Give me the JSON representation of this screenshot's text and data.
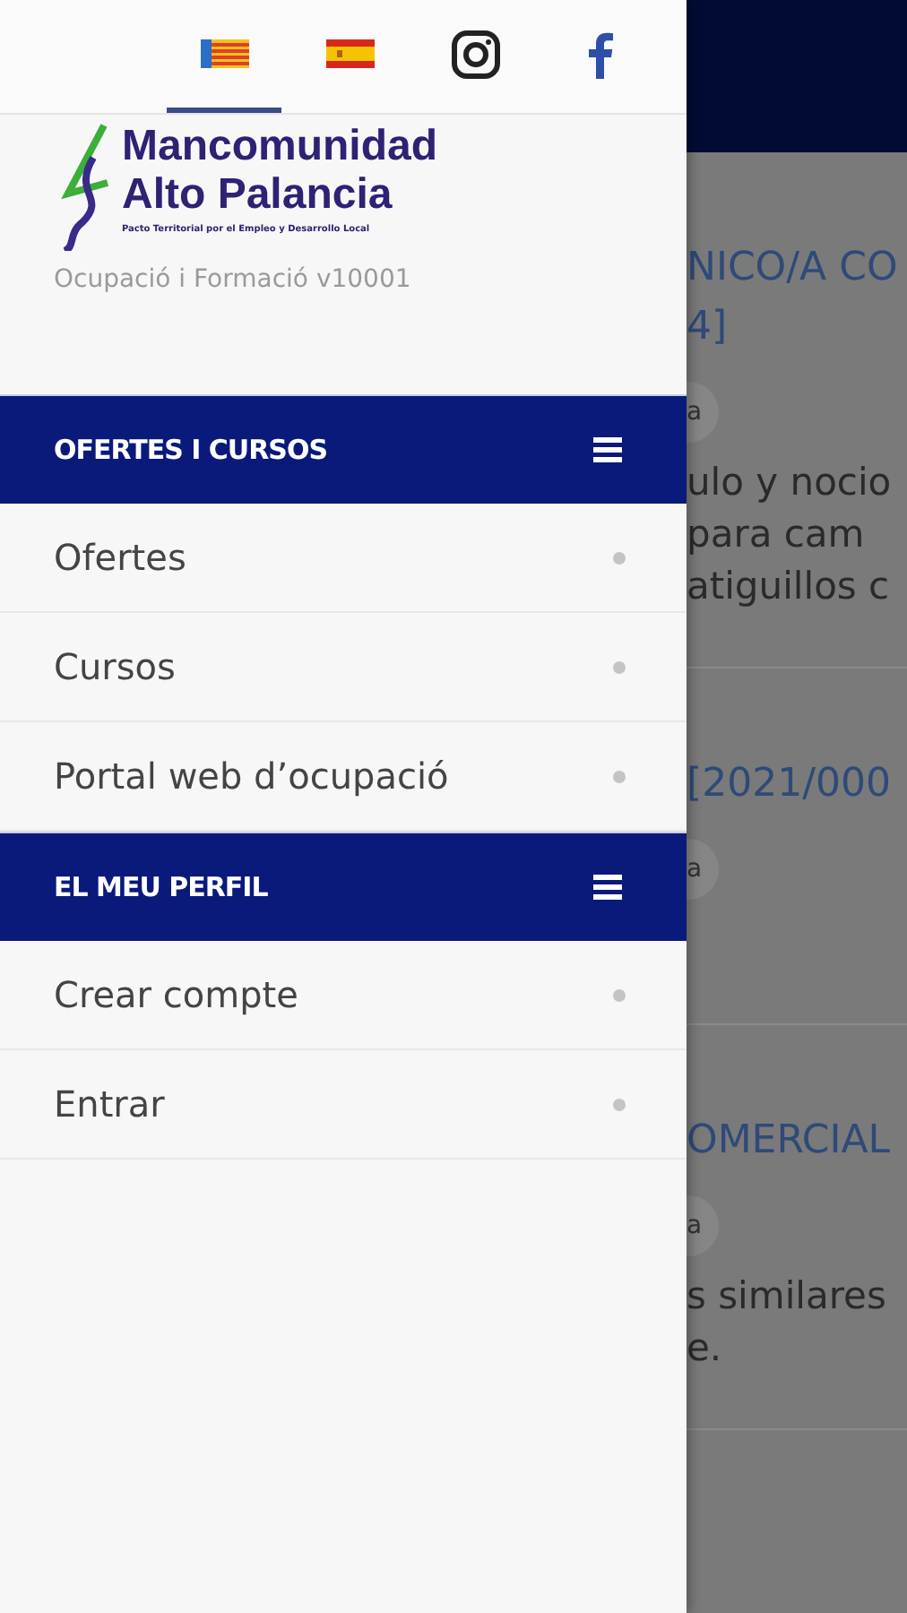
{
  "drawer": {
    "languages": [
      {
        "kind": "valencian",
        "selected": true
      },
      {
        "kind": "spanish",
        "selected": false
      }
    ],
    "social": [
      {
        "kind": "instagram"
      },
      {
        "kind": "facebook"
      }
    ],
    "logo": {
      "line_1": "Mancomunidad",
      "line_2": "Alto Palancia",
      "tagline": "Pacto Territorial por el Empleo y Desarrollo Local"
    },
    "app_subtitle": "Ocupació i Formació v10001",
    "sections": [
      {
        "title": "OFERTES I CURSOS",
        "items": [
          "Ofertes",
          "Cursos",
          "Portal web d’ocupació"
        ]
      },
      {
        "title": "EL MEU PERFIL",
        "items": [
          "Crear compte",
          "Entrar"
        ]
      }
    ]
  },
  "background": {
    "cards": [
      {
        "title_lines": [
          "NICO/A CO",
          "4]"
        ],
        "tag": "a",
        "description_lines": [
          "ulo y nocio",
          "para cam",
          "atiguillos c"
        ]
      },
      {
        "title_lines": [
          "[2021/000"
        ],
        "tag": "a"
      },
      {
        "title_lines": [
          "OMERCIAL"
        ],
        "tag": "a",
        "description_lines": [
          "s similares",
          "e."
        ]
      }
    ]
  }
}
